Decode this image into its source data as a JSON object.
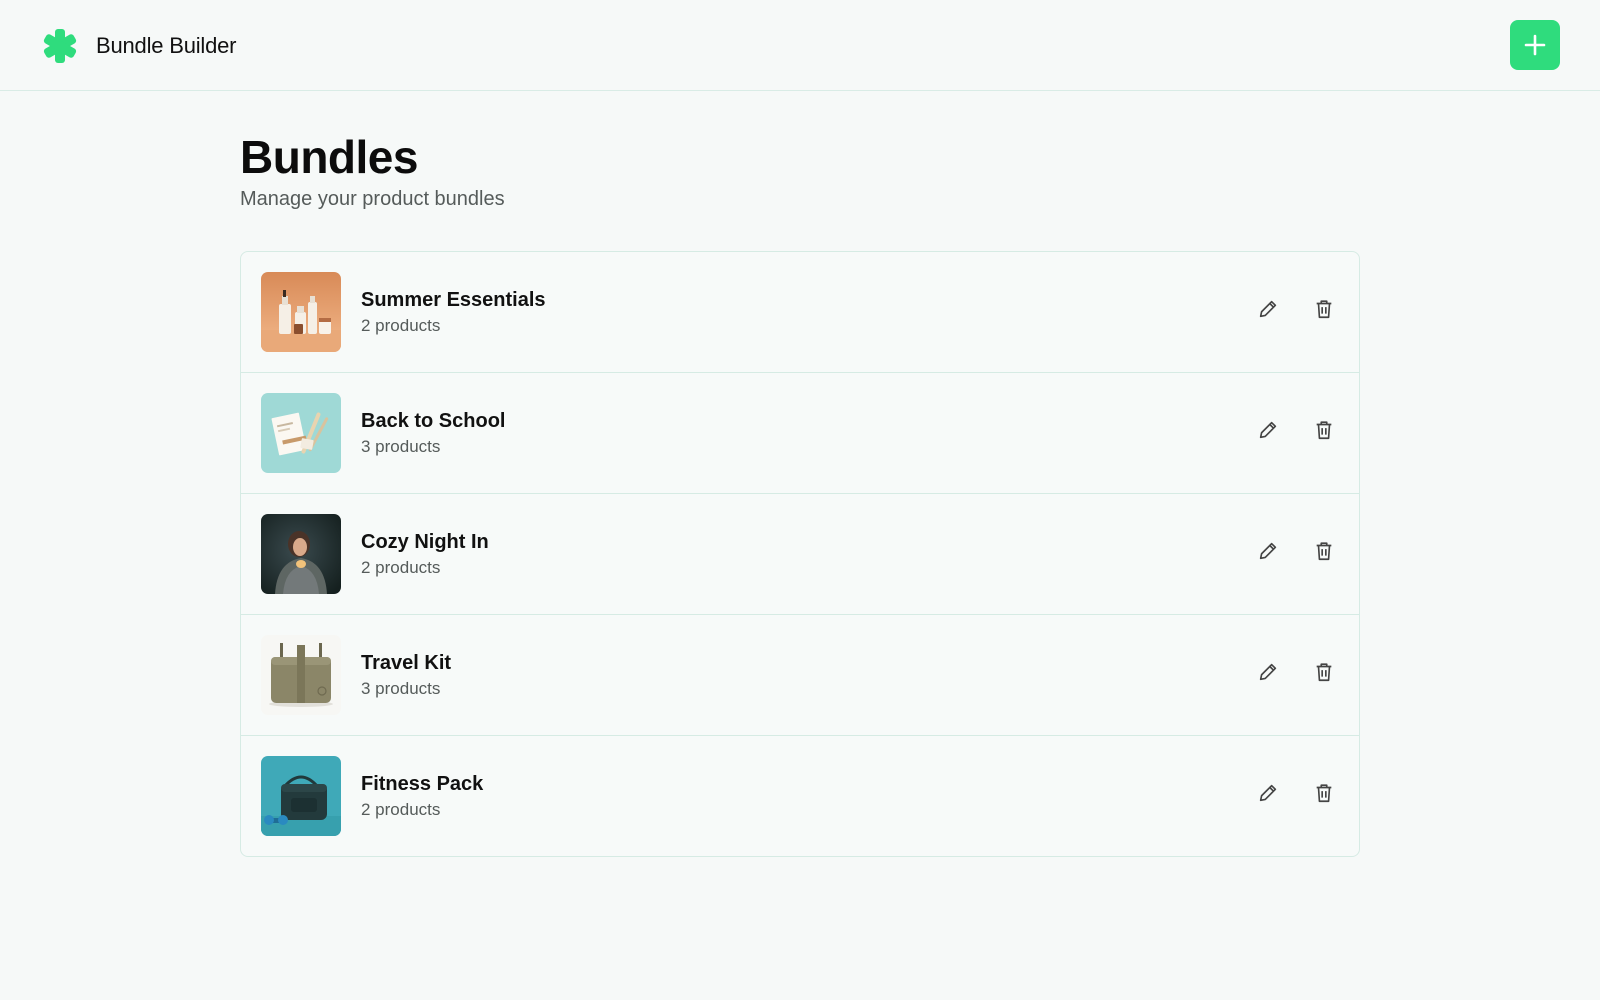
{
  "app": {
    "title": "Bundle Builder",
    "accent_color": "#2fdc7d",
    "logo_icon": "asterisk-logo-icon",
    "add_icon": "plus-icon"
  },
  "page": {
    "title": "Bundles",
    "subtitle": "Manage your product bundles"
  },
  "bundles": [
    {
      "name": "Summer Essentials",
      "count": "2 products",
      "thumbnail": "skincare-bottles-image"
    },
    {
      "name": "Back to School",
      "count": "3 products",
      "thumbnail": "stationery-image"
    },
    {
      "name": "Cozy Night In",
      "count": "2 products",
      "thumbnail": "person-blanket-image"
    },
    {
      "name": "Travel Kit",
      "count": "3 products",
      "thumbnail": "travel-bag-image"
    },
    {
      "name": "Fitness Pack",
      "count": "2 products",
      "thumbnail": "gym-bag-dumbbell-image"
    }
  ],
  "row_actions": {
    "edit_icon": "pencil-icon",
    "delete_icon": "trash-icon"
  }
}
